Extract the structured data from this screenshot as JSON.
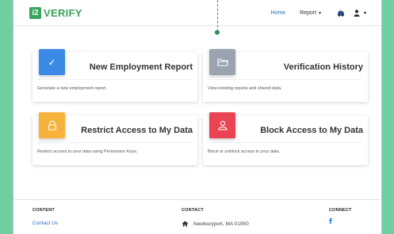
{
  "brand": {
    "badge": "i2",
    "name": "VERIFY",
    "color": "#3aa35c"
  },
  "nav": {
    "home": "Home",
    "report": "Report",
    "icons": [
      "car-icon",
      "user-icon"
    ]
  },
  "cards": [
    {
      "title": "New Employment Report",
      "description": "Generate a new employment report.",
      "icon": "check-icon",
      "color": "#3b8be6"
    },
    {
      "title": "Verification History",
      "description": "View existing reports and shared data.",
      "icon": "folder-icon",
      "color": "#9aa3b0"
    },
    {
      "title": "Restrict Access to My Data",
      "description": "Restrict access to your data using Permission Keys.",
      "icon": "lock-icon",
      "color": "#f6b23a"
    },
    {
      "title": "Block Access to My Data",
      "description": "Block or unblock access to your data.",
      "icon": "user-icon",
      "color": "#ea4452"
    }
  ],
  "footer": {
    "content": {
      "heading": "CONTENT",
      "link": "Contact Us"
    },
    "contact": {
      "heading": "CONTACT",
      "address": "Newburyport, MA 01950",
      "icon": "home-icon"
    },
    "connect": {
      "heading": "CONNECT",
      "icon": "facebook-icon"
    }
  }
}
